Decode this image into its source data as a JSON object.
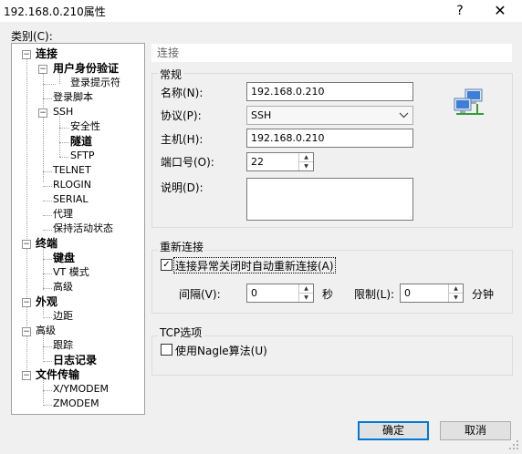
{
  "window": {
    "title": "192.168.0.210属性",
    "help_icon": "?",
    "close_icon": "✕"
  },
  "category": {
    "label": "类别(C):",
    "tree": [
      {
        "label": "连接",
        "bold": true,
        "expander": "−"
      },
      {
        "label": "用户身份验证",
        "bold": true,
        "expander": "−"
      },
      {
        "label": "登录提示符",
        "bold": false
      },
      {
        "label": "登录脚本",
        "bold": false
      },
      {
        "label": "SSH",
        "bold": false,
        "expander": "−"
      },
      {
        "label": "安全性",
        "bold": false
      },
      {
        "label": "隧道",
        "bold": true
      },
      {
        "label": "SFTP",
        "bold": false
      },
      {
        "label": "TELNET",
        "bold": false
      },
      {
        "label": "RLOGIN",
        "bold": false
      },
      {
        "label": "SERIAL",
        "bold": false
      },
      {
        "label": "代理",
        "bold": false
      },
      {
        "label": "保持活动状态",
        "bold": false
      },
      {
        "label": "终端",
        "bold": true,
        "expander": "−"
      },
      {
        "label": "键盘",
        "bold": true
      },
      {
        "label": "VT 模式",
        "bold": false
      },
      {
        "label": "高级",
        "bold": false
      },
      {
        "label": "外观",
        "bold": true,
        "expander": "−"
      },
      {
        "label": "边距",
        "bold": false
      },
      {
        "label": "高级",
        "bold": false,
        "expander": "−"
      },
      {
        "label": "跟踪",
        "bold": false
      },
      {
        "label": "日志记录",
        "bold": true
      },
      {
        "label": "文件传输",
        "bold": true,
        "expander": "−"
      },
      {
        "label": "X/YMODEM",
        "bold": false
      },
      {
        "label": "ZMODEM",
        "bold": false
      }
    ]
  },
  "panel": {
    "header": "连接"
  },
  "general": {
    "title": "常规",
    "name_label": "名称(N):",
    "name_value": "192.168.0.210",
    "protocol_label": "协议(P):",
    "protocol_value": "SSH",
    "host_label": "主机(H):",
    "host_value": "192.168.0.210",
    "port_label": "端口号(O):",
    "port_value": "22",
    "desc_label": "说明(D):",
    "desc_value": ""
  },
  "reconnect": {
    "title": "重新连接",
    "auto_label": "连接异常关闭时自动重新连接(A)",
    "auto_checked": true,
    "interval_label": "间隔(V):",
    "interval_value": "0",
    "interval_unit": "秒",
    "limit_label": "限制(L):",
    "limit_value": "0",
    "limit_unit": "分钟"
  },
  "tcp": {
    "title": "TCP选项",
    "nagle_label": "使用Nagle算法(U)",
    "nagle_checked": false
  },
  "buttons": {
    "ok": "确定",
    "cancel": "取消"
  },
  "icons": {
    "connection": "network-computers-icon",
    "check": "✓"
  }
}
